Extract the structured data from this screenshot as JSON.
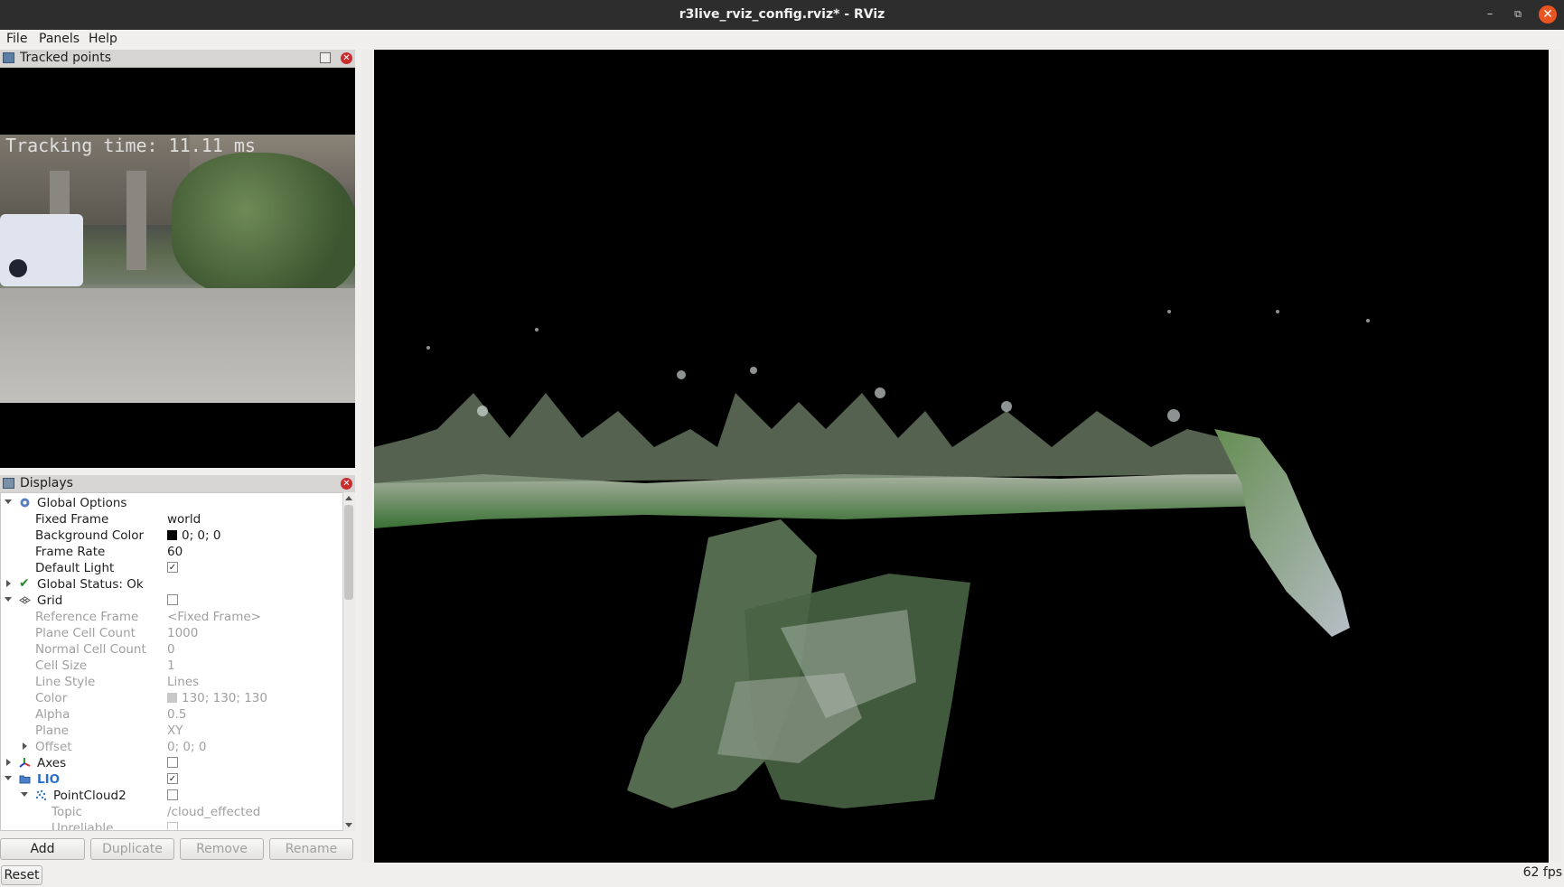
{
  "window": {
    "title": "r3live_rviz_config.rviz* - RViz"
  },
  "menu": {
    "file": "File",
    "panels": "Panels",
    "help": "Help"
  },
  "camera_panel": {
    "title": "Tracked points",
    "overlay_text": "Tracking time: 11.11 ms"
  },
  "displays_panel": {
    "title": "Displays",
    "rows": [
      {
        "key": "Global Options"
      },
      {
        "key": "Fixed Frame",
        "value": "world"
      },
      {
        "key": "Background Color",
        "value": "0; 0; 0",
        "swatch": "#000000"
      },
      {
        "key": "Frame Rate",
        "value": "60"
      },
      {
        "key": "Default Light",
        "checked": true
      },
      {
        "key": "Global Status: Ok"
      },
      {
        "key": "Grid",
        "checked": false
      },
      {
        "key": "Reference Frame",
        "value": "<Fixed Frame>"
      },
      {
        "key": "Plane Cell Count",
        "value": "1000"
      },
      {
        "key": "Normal Cell Count",
        "value": "0"
      },
      {
        "key": "Cell Size",
        "value": "1"
      },
      {
        "key": "Line Style",
        "value": "Lines"
      },
      {
        "key": "Color",
        "value": "130; 130; 130",
        "swatch": "#828282"
      },
      {
        "key": "Alpha",
        "value": "0.5"
      },
      {
        "key": "Plane",
        "value": "XY"
      },
      {
        "key": "Offset",
        "value": "0; 0; 0"
      },
      {
        "key": "Axes",
        "checked": false
      },
      {
        "key": "LIO",
        "checked": true,
        "color": "#2a6fc9"
      },
      {
        "key": "PointCloud2",
        "checked": false
      },
      {
        "key": "Topic",
        "value": "/cloud_effected"
      },
      {
        "key": "Unreliable",
        "checked": false
      }
    ]
  },
  "buttons": {
    "add": "Add",
    "duplicate": "Duplicate",
    "remove": "Remove",
    "rename": "Rename"
  },
  "status": {
    "reset": "Reset",
    "fps": "62 fps"
  },
  "icons": {
    "min": "minimize-icon",
    "max": "maximize-icon",
    "close": "close-icon"
  }
}
